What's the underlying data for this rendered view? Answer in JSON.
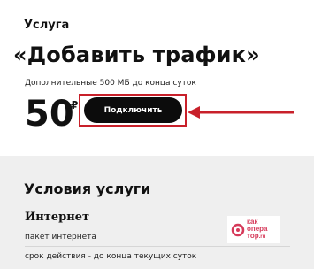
{
  "service": {
    "eyebrow": "Услуга",
    "title": "«Добавить трафик»",
    "subtitle": "Дополнительные 500 МБ до конца суток",
    "price": "50",
    "currency": "₽",
    "connect_label": "Подключить"
  },
  "conditions": {
    "title": "Условия услуги",
    "section": "Интернет",
    "rows": [
      "пакет интернета",
      "срок действия - до конца текущих суток"
    ]
  },
  "watermark": {
    "line1": "как",
    "line2": "опера",
    "line3": "тор",
    "line3_suffix": ".ru"
  },
  "colors": {
    "accent_red": "#c8202a",
    "button_bg": "#0c0c0c",
    "panel_bg": "#efefef"
  },
  "icons": {
    "arrow": "red-arrow-left-icon",
    "watermark_logo": "pin-logo-icon"
  }
}
